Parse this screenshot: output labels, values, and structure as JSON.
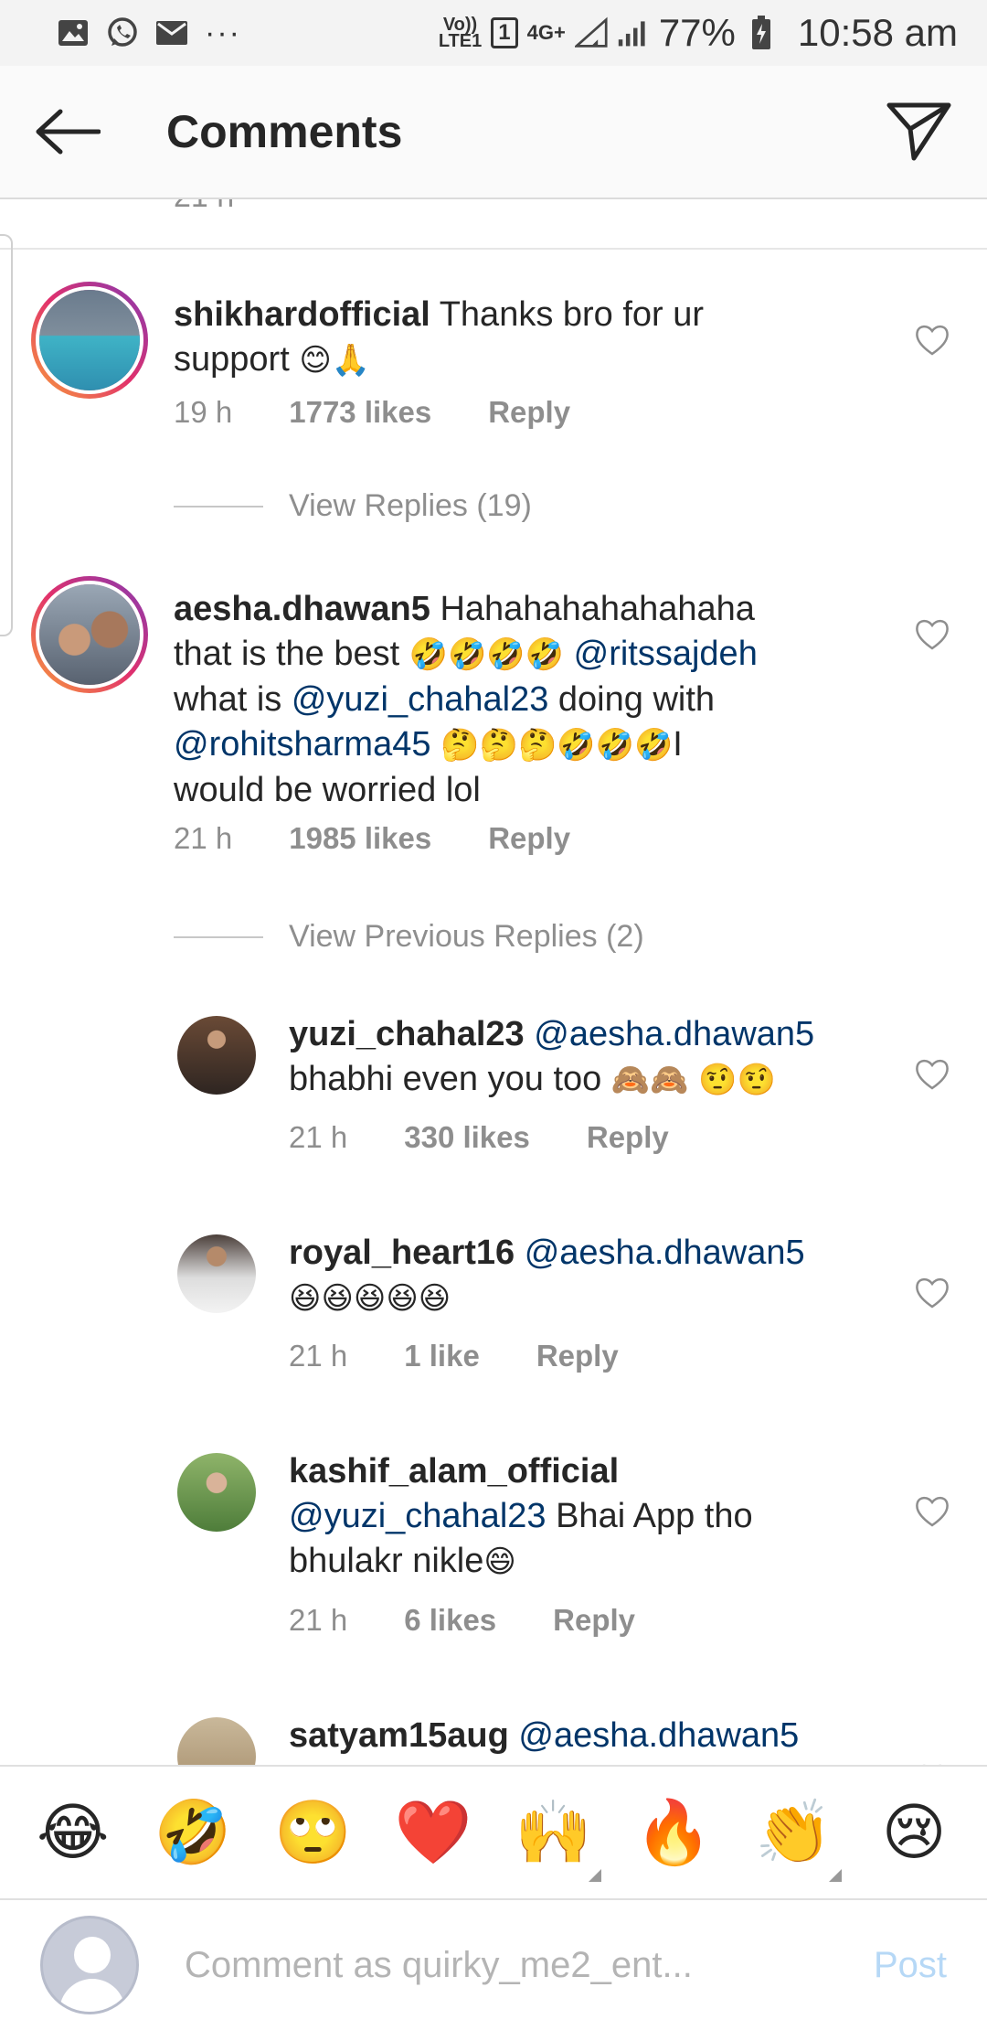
{
  "status_bar": {
    "network_label_top": "Vo))",
    "network_label_bottom": "LTE1",
    "sim_badge": "1",
    "data_label": "4G+",
    "battery": "77%",
    "time": "10:58 am",
    "more_label": "···"
  },
  "header": {
    "title": "Comments"
  },
  "cut_time": "21 h",
  "comments": [
    {
      "username": "shikhardofficial",
      "text_1": " Thanks bro for ur",
      "text_2": "support ",
      "emoji": "😊🙏",
      "time": "19 h",
      "likes": "1773 likes",
      "reply": "Reply"
    },
    {
      "username": "aesha.dhawan5",
      "text_1": " Hahahahahahahaha",
      "text_2": "that is the best ",
      "emoji_1": "🤣🤣🤣🤣",
      "mention_1": " @ritssajdeh",
      "text_3": "what is ",
      "mention_2": "@yuzi_chahal23",
      "text_4": " doing with",
      "mention_3": "@rohitsharma45",
      "emoji_2": " 🤔🤔🤔🤣🤣🤣",
      "text_5": "I",
      "text_6": "would be worried lol",
      "time": "21 h",
      "likes": "1985 likes",
      "reply": "Reply"
    }
  ],
  "view_replies_1": "View Replies (19)",
  "view_replies_2": "View Previous Replies (2)",
  "replies": [
    {
      "username": "yuzi_chahal23",
      "mention": " @aesha.dhawan5",
      "text": "bhabhi even you too ",
      "emoji": "🙈🙈 🤨🤨",
      "time": "21 h",
      "likes": "330 likes",
      "reply": "Reply"
    },
    {
      "username": "royal_heart16",
      "mention": " @aesha.dhawan5",
      "emoji": "😆😆😆😆😆",
      "time": "21 h",
      "likes": "1 like",
      "reply": "Reply"
    },
    {
      "username": "kashif_alam_official",
      "mention": "@yuzi_chahal23",
      "text_1": "  Bhai App tho",
      "text_2": "bhulakr nikle",
      "emoji": "😄",
      "time": "21 h",
      "likes": "6 likes",
      "reply": "Reply"
    },
    {
      "username": "satyam15aug",
      "mention": " @aesha.dhawan5"
    }
  ],
  "emoji_bar": [
    "😂",
    "🤣",
    "🙄",
    "❤️",
    "🙌",
    "🔥",
    "👏",
    "😢"
  ],
  "input": {
    "placeholder": "Comment as quirky_me2_ent...",
    "post_label": "Post"
  },
  "colors": {
    "mention": "#003569",
    "meta": "#8e8e8e",
    "post_disabled": "#b6d8f6"
  }
}
